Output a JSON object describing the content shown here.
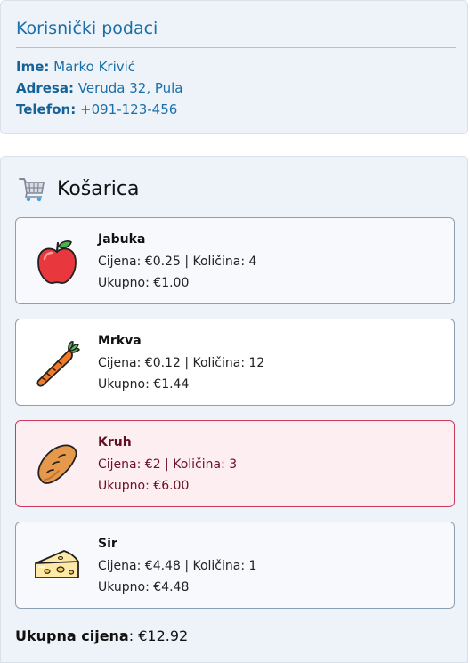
{
  "user": {
    "title": "Korisnički podaci",
    "fields": [
      {
        "label": "Ime:",
        "value": "Marko Krivić"
      },
      {
        "label": "Adresa:",
        "value": "Veruda 32, Pula"
      },
      {
        "label": "Telefon:",
        "value": "+091-123-456"
      }
    ]
  },
  "cart": {
    "title": "Košarica",
    "icon": "shopping-cart-icon",
    "items": [
      {
        "name": "Jabuka",
        "price_line": "Cijena: €0.25 | Količina: 4",
        "total_line": "Ukupno: €1.00",
        "icon": "apple-icon",
        "highlighted": false
      },
      {
        "name": "Mrkva",
        "price_line": "Cijena: €0.12 | Količina: 12",
        "total_line": "Ukupno: €1.44",
        "icon": "carrot-icon",
        "highlighted": false
      },
      {
        "name": "Kruh",
        "price_line": "Cijena: €2 | Količina: 3",
        "total_line": "Ukupno: €6.00",
        "icon": "bread-icon",
        "highlighted": true
      },
      {
        "name": "Sir",
        "price_line": "Cijena: €4.48 | Količina: 1",
        "total_line": "Ukupno: €4.48",
        "icon": "cheese-icon",
        "highlighted": false
      }
    ],
    "grand_total_label": "Ukupna cijena",
    "grand_total_value": ": €12.92"
  },
  "colors": {
    "accent": "#1a6fa8",
    "highlight_border": "#cc3a5e",
    "highlight_bg": "#fdeef1"
  }
}
